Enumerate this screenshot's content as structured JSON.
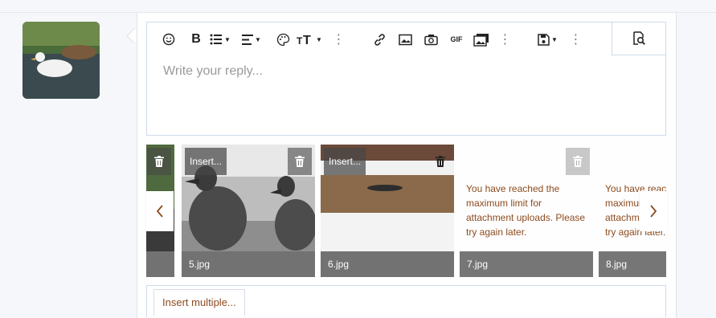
{
  "editor": {
    "placeholder": "Write your reply..."
  },
  "toolbar": {
    "icons": [
      "smile-icon",
      "bold-icon",
      "list-icon",
      "align-icon",
      "palette-icon",
      "font-size-icon",
      "more-icon",
      "link-icon",
      "image-icon",
      "camera-icon",
      "gif-icon",
      "media-gallery-icon",
      "more-icon",
      "draft-icon",
      "more-icon",
      "preview-icon"
    ],
    "gif_label": "GIF"
  },
  "attachments": [
    {
      "name": "",
      "has_insert": false
    },
    {
      "name": "5.jpg",
      "insert_label": "Insert..."
    },
    {
      "name": "6.jpg",
      "insert_label": "Insert..."
    },
    {
      "name": "7.jpg",
      "limit_message": "You have reached the maximum limit for attachment uploads. Please try again later."
    },
    {
      "name": "8.jpg",
      "limit_message": "You have reached the maximum limit for attachment uploads. Please try again later."
    }
  ],
  "footer": {
    "insert_multiple_label": "Insert multiple..."
  },
  "colors": {
    "accent_link": "#8c4b1e",
    "border": "#cfdbeb"
  }
}
